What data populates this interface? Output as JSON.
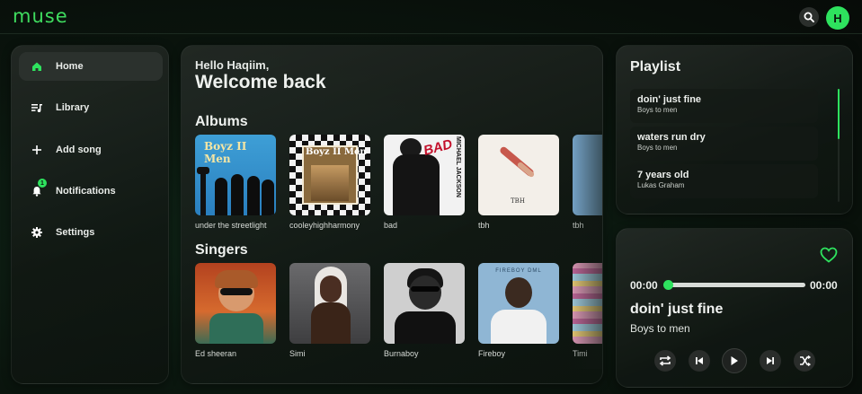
{
  "app": {
    "logo": "muse"
  },
  "header": {
    "avatar_initial": "H"
  },
  "sidebar": {
    "items": [
      {
        "label": "Home",
        "icon": "home-icon",
        "active": true
      },
      {
        "label": "Library",
        "icon": "library-icon"
      },
      {
        "label": "Add song",
        "icon": "plus-icon"
      },
      {
        "label": "Notifications",
        "icon": "bell-icon",
        "badge": "1"
      },
      {
        "label": "Settings",
        "icon": "gear-icon"
      }
    ]
  },
  "main": {
    "greeting": "Hello Haqiim,",
    "welcome": "Welcome back",
    "albums_title": "Albums",
    "albums": [
      {
        "caption": "under the streetlight",
        "art_text": "Boyz II Men"
      },
      {
        "caption": "cooleyhighharmony",
        "art_text": "Boyz II Men"
      },
      {
        "caption": "bad",
        "art_text": "MICHAEL JACKSON"
      },
      {
        "caption": "tbh",
        "art_text": "TBH"
      },
      {
        "caption": "tbh"
      }
    ],
    "singers_title": "Singers",
    "singers": [
      {
        "caption": "Ed sheeran"
      },
      {
        "caption": "Simi"
      },
      {
        "caption": "Burnaboy"
      },
      {
        "caption": "Fireboy",
        "art_text": "FIREBOY DML"
      },
      {
        "caption": "Timi"
      }
    ]
  },
  "playlist": {
    "title": "Playlist",
    "items": [
      {
        "title": "doin' just fine",
        "artist": "Boys to men"
      },
      {
        "title": "waters run dry",
        "artist": "Boys to men"
      },
      {
        "title": "7 years old",
        "artist": "Lukas Graham"
      }
    ]
  },
  "player": {
    "elapsed": "00:00",
    "duration": "00:00",
    "progress": 0,
    "title": "doin' just fine",
    "artist": "Boys to men"
  },
  "colors": {
    "accent": "#2ee25e",
    "logo": "#3fdc5f",
    "background": "#0a140d"
  }
}
